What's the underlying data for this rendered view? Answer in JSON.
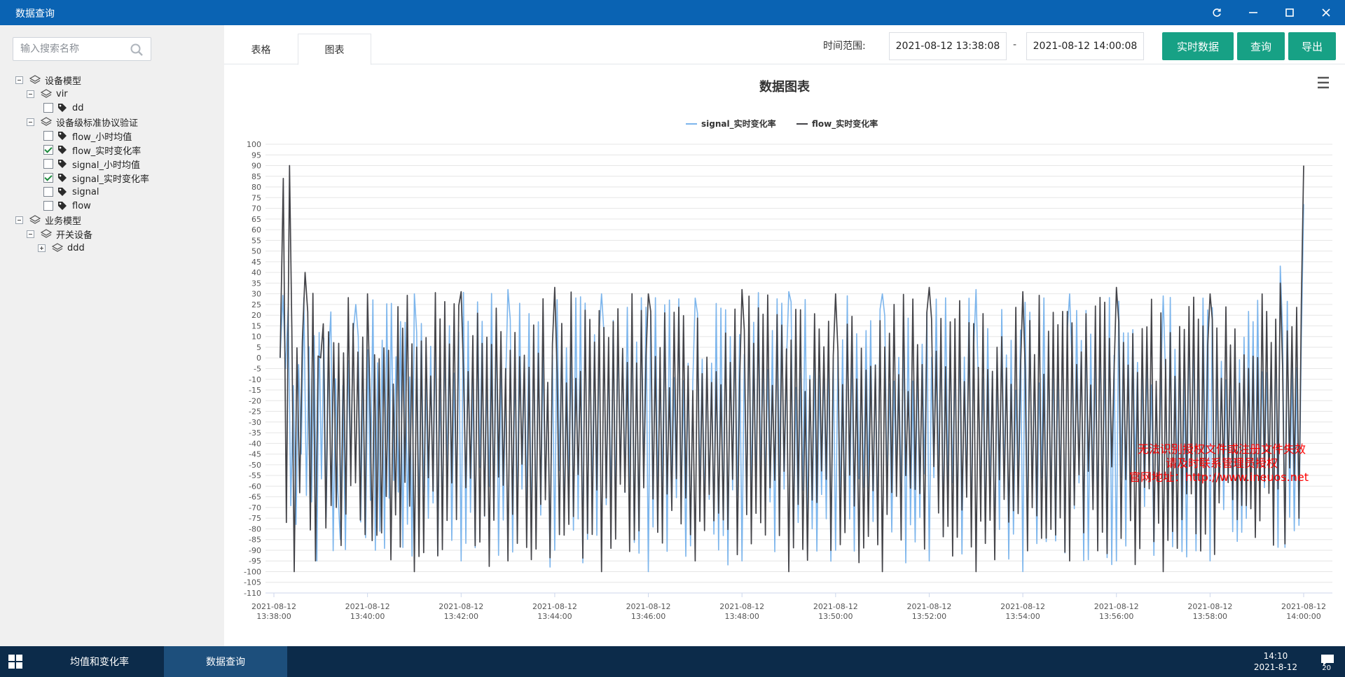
{
  "window": {
    "title": "数据查询"
  },
  "sidebar": {
    "search_placeholder": "输入搜索名称",
    "tree": [
      {
        "label": "设备模型",
        "level": 0,
        "kind": "folder",
        "expanded": true
      },
      {
        "label": "vir",
        "level": 1,
        "kind": "folder",
        "expanded": true
      },
      {
        "label": "dd",
        "level": 2,
        "kind": "tag",
        "checked": false
      },
      {
        "label": "设备级标准协议验证",
        "level": 1,
        "kind": "folder",
        "expanded": true
      },
      {
        "label": "flow_小时均值",
        "level": 2,
        "kind": "tag",
        "checked": false
      },
      {
        "label": "flow_实时变化率",
        "level": 2,
        "kind": "tag",
        "checked": true
      },
      {
        "label": "signal_小时均值",
        "level": 2,
        "kind": "tag",
        "checked": false
      },
      {
        "label": "signal_实时变化率",
        "level": 2,
        "kind": "tag",
        "checked": true
      },
      {
        "label": "signal",
        "level": 2,
        "kind": "tag",
        "checked": false
      },
      {
        "label": "flow",
        "level": 2,
        "kind": "tag",
        "checked": false
      },
      {
        "label": "业务模型",
        "level": 0,
        "kind": "folder",
        "expanded": true
      },
      {
        "label": "开关设备",
        "level": 1,
        "kind": "folder",
        "expanded": true
      },
      {
        "label": "ddd",
        "level": 2,
        "kind": "folder",
        "expanded": false
      }
    ]
  },
  "tabs": [
    {
      "label": "表格",
      "active": false
    },
    {
      "label": "图表",
      "active": true
    }
  ],
  "toolbar": {
    "range_label": "时间范围:",
    "start_time": "2021-08-12 13:38:08",
    "separator": "-",
    "end_time": "2021-08-12 14:00:08",
    "realtime_label": "实时数据",
    "query_label": "查询",
    "export_label": "导出"
  },
  "colors": {
    "titlebar": "#0a63b3",
    "accent_button": "#17a185",
    "signal_series": "#7cb5ec",
    "flow_series": "#434348",
    "watermark": "#ff0000"
  },
  "chart_data": {
    "type": "line",
    "title": "数据图表",
    "legend_position": "top-center",
    "grid": true,
    "ylim": [
      -110,
      100
    ],
    "y_ticks": [
      100,
      95,
      90,
      85,
      80,
      75,
      70,
      65,
      60,
      55,
      50,
      45,
      40,
      35,
      30,
      25,
      20,
      15,
      10,
      5,
      0,
      -5,
      -10,
      -15,
      -20,
      -25,
      -30,
      -35,
      -40,
      -45,
      -50,
      -55,
      -60,
      -65,
      -70,
      -75,
      -80,
      -85,
      -90,
      -95,
      -100,
      -105,
      -110
    ],
    "x_range": [
      "2021-08-12 13:38:00",
      "2021-08-12 14:00:00"
    ],
    "x_ticks": [
      {
        "date": "2021-08-12",
        "time": "13:38:00"
      },
      {
        "date": "2021-08-12",
        "time": "13:40:00"
      },
      {
        "date": "2021-08-12",
        "time": "13:42:00"
      },
      {
        "date": "2021-08-12",
        "time": "13:44:00"
      },
      {
        "date": "2021-08-12",
        "time": "13:46:00"
      },
      {
        "date": "2021-08-12",
        "time": "13:48:00"
      },
      {
        "date": "2021-08-12",
        "time": "13:50:00"
      },
      {
        "date": "2021-08-12",
        "time": "13:52:00"
      },
      {
        "date": "2021-08-12",
        "time": "13:54:00"
      },
      {
        "date": "2021-08-12",
        "time": "13:56:00"
      },
      {
        "date": "2021-08-12",
        "time": "13:58:00"
      },
      {
        "date": "2021-08-12",
        "time": "14:00:00"
      }
    ],
    "series": [
      {
        "name": "signal_实时变化率",
        "color": "#7cb5ec",
        "values_summary": "dense oscillation roughly between -100 and 32 across the whole range, reaching ~72 at the end",
        "values": [
          {
            "x": "2021-08-12 13:38:08",
            "y": 0
          },
          {
            "x": "2021-08-12 13:38:15",
            "y": -5
          },
          {
            "x": "2021-08-12 13:38:35",
            "y": -45
          },
          {
            "x": "2021-08-12 13:38:55",
            "y": -95
          },
          {
            "x": "2021-08-12 13:39:10",
            "y": 0
          },
          {
            "x": "2021-08-12 13:39:25",
            "y": -85
          },
          {
            "x": "2021-08-12 13:39:45",
            "y": 25
          },
          {
            "x": "2021-08-12 13:40:10",
            "y": -90
          },
          {
            "x": "2021-08-12 13:41:00",
            "y": 30
          },
          {
            "x": "2021-08-12 13:42:00",
            "y": -95
          },
          {
            "x": "2021-08-12 13:43:00",
            "y": 32
          },
          {
            "x": "2021-08-12 13:44:00",
            "y": -90
          },
          {
            "x": "2021-08-12 13:45:00",
            "y": 30
          },
          {
            "x": "2021-08-12 13:46:00",
            "y": -100
          },
          {
            "x": "2021-08-12 13:47:00",
            "y": 28
          },
          {
            "x": "2021-08-12 13:48:00",
            "y": -95
          },
          {
            "x": "2021-08-12 13:49:00",
            "y": 31
          },
          {
            "x": "2021-08-12 13:50:00",
            "y": -90
          },
          {
            "x": "2021-08-12 13:51:00",
            "y": 30
          },
          {
            "x": "2021-08-12 13:52:00",
            "y": -95
          },
          {
            "x": "2021-08-12 13:53:00",
            "y": 32
          },
          {
            "x": "2021-08-12 13:54:00",
            "y": -100
          },
          {
            "x": "2021-08-12 13:55:00",
            "y": 30
          },
          {
            "x": "2021-08-12 13:56:00",
            "y": -95
          },
          {
            "x": "2021-08-12 13:57:00",
            "y": 29
          },
          {
            "x": "2021-08-12 13:58:00",
            "y": -95
          },
          {
            "x": "2021-08-12 13:59:30",
            "y": 43
          },
          {
            "x": "2021-08-12 14:00:00",
            "y": 72
          }
        ]
      },
      {
        "name": "flow_实时变化率",
        "color": "#434348",
        "values_summary": "dense oscillation roughly between -100 and 34 across the whole range, with early spikes to ~84 and ~90 and a final spike to ~90",
        "values": [
          {
            "x": "2021-08-12 13:38:08",
            "y": 0
          },
          {
            "x": "2021-08-12 13:38:12",
            "y": 84
          },
          {
            "x": "2021-08-12 13:38:16",
            "y": -77
          },
          {
            "x": "2021-08-12 13:38:20",
            "y": 90
          },
          {
            "x": "2021-08-12 13:38:26",
            "y": -100
          },
          {
            "x": "2021-08-12 13:38:40",
            "y": 40
          },
          {
            "x": "2021-08-12 13:39:00",
            "y": 0
          },
          {
            "x": "2021-08-12 13:39:20",
            "y": -70
          },
          {
            "x": "2021-08-12 13:40:00",
            "y": 30
          },
          {
            "x": "2021-08-12 13:41:00",
            "y": -100
          },
          {
            "x": "2021-08-12 13:42:00",
            "y": 31
          },
          {
            "x": "2021-08-12 13:43:00",
            "y": -95
          },
          {
            "x": "2021-08-12 13:44:00",
            "y": 33
          },
          {
            "x": "2021-08-12 13:45:00",
            "y": -100
          },
          {
            "x": "2021-08-12 13:46:00",
            "y": 30
          },
          {
            "x": "2021-08-12 13:47:00",
            "y": -95
          },
          {
            "x": "2021-08-12 13:48:00",
            "y": 32
          },
          {
            "x": "2021-08-12 13:49:00",
            "y": -100
          },
          {
            "x": "2021-08-12 13:50:00",
            "y": 30
          },
          {
            "x": "2021-08-12 13:51:00",
            "y": -100
          },
          {
            "x": "2021-08-12 13:52:00",
            "y": 33
          },
          {
            "x": "2021-08-12 13:53:00",
            "y": -100
          },
          {
            "x": "2021-08-12 13:54:00",
            "y": 31
          },
          {
            "x": "2021-08-12 13:55:00",
            "y": -95
          },
          {
            "x": "2021-08-12 13:56:00",
            "y": 33
          },
          {
            "x": "2021-08-12 13:57:00",
            "y": -100
          },
          {
            "x": "2021-08-12 13:58:00",
            "y": 30
          },
          {
            "x": "2021-08-12 13:59:30",
            "y": 35
          },
          {
            "x": "2021-08-12 14:00:00",
            "y": 90
          }
        ]
      }
    ],
    "watermark": [
      "无法识别授权文件或注册文件失效",
      "请及时联系管理员授权",
      "官网地址：http://www.ineuos.net"
    ]
  },
  "taskbar": {
    "tasks": [
      {
        "label": "均值和变化率",
        "active": false
      },
      {
        "label": "数据查询",
        "active": true
      }
    ],
    "time": "14:10",
    "date": "2021-8-12",
    "notification_count": "20"
  }
}
